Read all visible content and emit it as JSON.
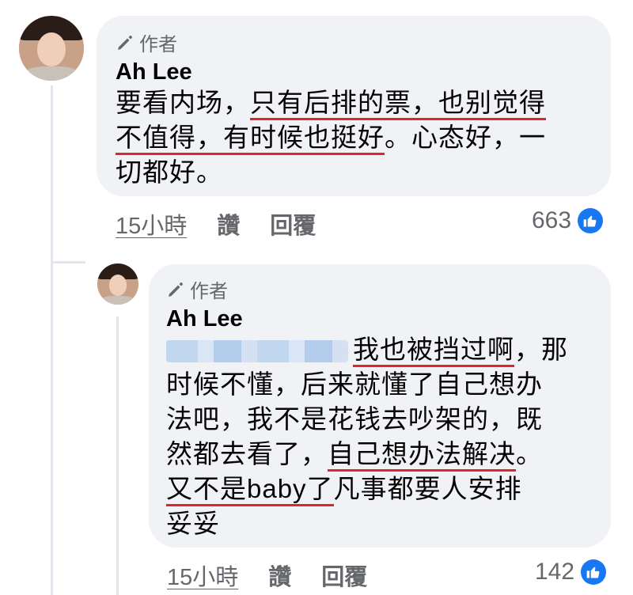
{
  "comment1": {
    "badge": "作者",
    "author": "Ah Lee",
    "lines": [
      {
        "pre": "要看内场，",
        "ul": "只有后排的票，也别觉得",
        "post": ""
      },
      {
        "pre": "",
        "ul": "不值得，有时候也挺好",
        "post": "。心态好，一"
      },
      {
        "pre": "切都好。",
        "ul": "",
        "post": ""
      }
    ],
    "time": "15小時",
    "like_label": "讚",
    "reply_label": "回覆",
    "like_count": "663"
  },
  "comment2": {
    "badge": "作者",
    "author": "Ah Lee",
    "lines": [
      {
        "pre": "",
        "ul": "我也被挡过啊",
        "post": "，那"
      },
      {
        "pre": "时候不懂，后来就懂了自己想办",
        "ul": "",
        "post": ""
      },
      {
        "pre": "法吧，我不是花钱去吵架的，既",
        "ul": "",
        "post": ""
      },
      {
        "pre": "然都去看了，",
        "ul": "自己想办法解决",
        "post": "。"
      },
      {
        "pre": "",
        "ul": "又不是baby了",
        "post": "凡事都要人安排"
      },
      {
        "pre": "妥妥",
        "ul": "",
        "post": ""
      }
    ],
    "time": "15小時",
    "like_label": "讚",
    "reply_label": "回覆",
    "like_count": "142"
  },
  "colors": {
    "accent": "#1877f2",
    "underline": "#e0242b",
    "bubble": "#f0f2f5",
    "meta": "#65676b"
  },
  "icons": {
    "badge": "pen-icon",
    "like": "thumbs-up-icon"
  }
}
